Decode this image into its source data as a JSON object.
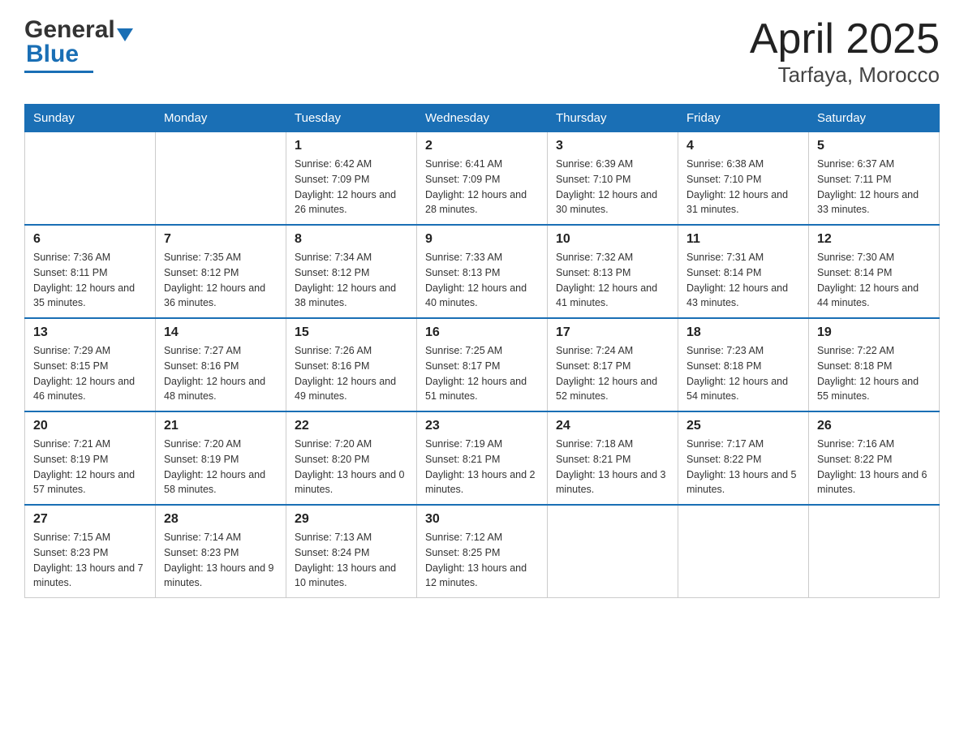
{
  "header": {
    "logo_general": "General",
    "logo_blue": "Blue",
    "title": "April 2025",
    "subtitle": "Tarfaya, Morocco"
  },
  "weekdays": [
    "Sunday",
    "Monday",
    "Tuesday",
    "Wednesday",
    "Thursday",
    "Friday",
    "Saturday"
  ],
  "weeks": [
    [
      {
        "day": "",
        "sunrise": "",
        "sunset": "",
        "daylight": ""
      },
      {
        "day": "",
        "sunrise": "",
        "sunset": "",
        "daylight": ""
      },
      {
        "day": "1",
        "sunrise": "Sunrise: 6:42 AM",
        "sunset": "Sunset: 7:09 PM",
        "daylight": "Daylight: 12 hours and 26 minutes."
      },
      {
        "day": "2",
        "sunrise": "Sunrise: 6:41 AM",
        "sunset": "Sunset: 7:09 PM",
        "daylight": "Daylight: 12 hours and 28 minutes."
      },
      {
        "day": "3",
        "sunrise": "Sunrise: 6:39 AM",
        "sunset": "Sunset: 7:10 PM",
        "daylight": "Daylight: 12 hours and 30 minutes."
      },
      {
        "day": "4",
        "sunrise": "Sunrise: 6:38 AM",
        "sunset": "Sunset: 7:10 PM",
        "daylight": "Daylight: 12 hours and 31 minutes."
      },
      {
        "day": "5",
        "sunrise": "Sunrise: 6:37 AM",
        "sunset": "Sunset: 7:11 PM",
        "daylight": "Daylight: 12 hours and 33 minutes."
      }
    ],
    [
      {
        "day": "6",
        "sunrise": "Sunrise: 7:36 AM",
        "sunset": "Sunset: 8:11 PM",
        "daylight": "Daylight: 12 hours and 35 minutes."
      },
      {
        "day": "7",
        "sunrise": "Sunrise: 7:35 AM",
        "sunset": "Sunset: 8:12 PM",
        "daylight": "Daylight: 12 hours and 36 minutes."
      },
      {
        "day": "8",
        "sunrise": "Sunrise: 7:34 AM",
        "sunset": "Sunset: 8:12 PM",
        "daylight": "Daylight: 12 hours and 38 minutes."
      },
      {
        "day": "9",
        "sunrise": "Sunrise: 7:33 AM",
        "sunset": "Sunset: 8:13 PM",
        "daylight": "Daylight: 12 hours and 40 minutes."
      },
      {
        "day": "10",
        "sunrise": "Sunrise: 7:32 AM",
        "sunset": "Sunset: 8:13 PM",
        "daylight": "Daylight: 12 hours and 41 minutes."
      },
      {
        "day": "11",
        "sunrise": "Sunrise: 7:31 AM",
        "sunset": "Sunset: 8:14 PM",
        "daylight": "Daylight: 12 hours and 43 minutes."
      },
      {
        "day": "12",
        "sunrise": "Sunrise: 7:30 AM",
        "sunset": "Sunset: 8:14 PM",
        "daylight": "Daylight: 12 hours and 44 minutes."
      }
    ],
    [
      {
        "day": "13",
        "sunrise": "Sunrise: 7:29 AM",
        "sunset": "Sunset: 8:15 PM",
        "daylight": "Daylight: 12 hours and 46 minutes."
      },
      {
        "day": "14",
        "sunrise": "Sunrise: 7:27 AM",
        "sunset": "Sunset: 8:16 PM",
        "daylight": "Daylight: 12 hours and 48 minutes."
      },
      {
        "day": "15",
        "sunrise": "Sunrise: 7:26 AM",
        "sunset": "Sunset: 8:16 PM",
        "daylight": "Daylight: 12 hours and 49 minutes."
      },
      {
        "day": "16",
        "sunrise": "Sunrise: 7:25 AM",
        "sunset": "Sunset: 8:17 PM",
        "daylight": "Daylight: 12 hours and 51 minutes."
      },
      {
        "day": "17",
        "sunrise": "Sunrise: 7:24 AM",
        "sunset": "Sunset: 8:17 PM",
        "daylight": "Daylight: 12 hours and 52 minutes."
      },
      {
        "day": "18",
        "sunrise": "Sunrise: 7:23 AM",
        "sunset": "Sunset: 8:18 PM",
        "daylight": "Daylight: 12 hours and 54 minutes."
      },
      {
        "day": "19",
        "sunrise": "Sunrise: 7:22 AM",
        "sunset": "Sunset: 8:18 PM",
        "daylight": "Daylight: 12 hours and 55 minutes."
      }
    ],
    [
      {
        "day": "20",
        "sunrise": "Sunrise: 7:21 AM",
        "sunset": "Sunset: 8:19 PM",
        "daylight": "Daylight: 12 hours and 57 minutes."
      },
      {
        "day": "21",
        "sunrise": "Sunrise: 7:20 AM",
        "sunset": "Sunset: 8:19 PM",
        "daylight": "Daylight: 12 hours and 58 minutes."
      },
      {
        "day": "22",
        "sunrise": "Sunrise: 7:20 AM",
        "sunset": "Sunset: 8:20 PM",
        "daylight": "Daylight: 13 hours and 0 minutes."
      },
      {
        "day": "23",
        "sunrise": "Sunrise: 7:19 AM",
        "sunset": "Sunset: 8:21 PM",
        "daylight": "Daylight: 13 hours and 2 minutes."
      },
      {
        "day": "24",
        "sunrise": "Sunrise: 7:18 AM",
        "sunset": "Sunset: 8:21 PM",
        "daylight": "Daylight: 13 hours and 3 minutes."
      },
      {
        "day": "25",
        "sunrise": "Sunrise: 7:17 AM",
        "sunset": "Sunset: 8:22 PM",
        "daylight": "Daylight: 13 hours and 5 minutes."
      },
      {
        "day": "26",
        "sunrise": "Sunrise: 7:16 AM",
        "sunset": "Sunset: 8:22 PM",
        "daylight": "Daylight: 13 hours and 6 minutes."
      }
    ],
    [
      {
        "day": "27",
        "sunrise": "Sunrise: 7:15 AM",
        "sunset": "Sunset: 8:23 PM",
        "daylight": "Daylight: 13 hours and 7 minutes."
      },
      {
        "day": "28",
        "sunrise": "Sunrise: 7:14 AM",
        "sunset": "Sunset: 8:23 PM",
        "daylight": "Daylight: 13 hours and 9 minutes."
      },
      {
        "day": "29",
        "sunrise": "Sunrise: 7:13 AM",
        "sunset": "Sunset: 8:24 PM",
        "daylight": "Daylight: 13 hours and 10 minutes."
      },
      {
        "day": "30",
        "sunrise": "Sunrise: 7:12 AM",
        "sunset": "Sunset: 8:25 PM",
        "daylight": "Daylight: 13 hours and 12 minutes."
      },
      {
        "day": "",
        "sunrise": "",
        "sunset": "",
        "daylight": ""
      },
      {
        "day": "",
        "sunrise": "",
        "sunset": "",
        "daylight": ""
      },
      {
        "day": "",
        "sunrise": "",
        "sunset": "",
        "daylight": ""
      }
    ]
  ]
}
